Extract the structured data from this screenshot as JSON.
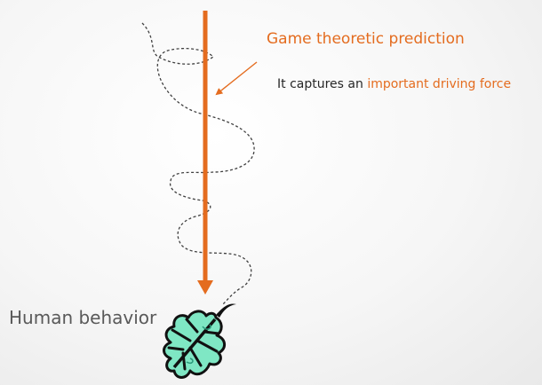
{
  "prediction_label": "Game theoretic prediction",
  "captures_label": {
    "prefix": "It captures an ",
    "highlight": "important driving force"
  },
  "human_behavior_label": "Human behavior",
  "colors": {
    "accent_orange": "#e46c1f",
    "dark_text": "#262626",
    "gray_text": "#595959",
    "dotted_path": "#404040",
    "leaf_fill": "#7fe7c4",
    "leaf_outline": "#111111"
  },
  "icons": {
    "leaf": "falling-leaf-icon"
  }
}
